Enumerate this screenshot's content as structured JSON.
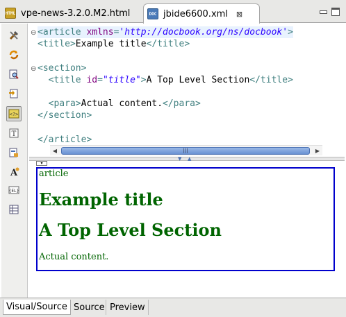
{
  "tabs": [
    {
      "label": "vpe-news-3.2.0.M2.html",
      "icon": "html-file-icon",
      "icon_text": "HTML",
      "active": false
    },
    {
      "label": "jbide6600.xml",
      "icon": "docbook-file-icon",
      "icon_text": "DOC",
      "active": true
    }
  ],
  "tab_close_glyph": "⊠",
  "palette": [
    "tools-icon",
    "refresh-icon",
    "preview-icon",
    "bundle-icon",
    "source-toggle-icon",
    "text-icon",
    "format-icon",
    "font-icon",
    "el-icon",
    "table-icon"
  ],
  "source": {
    "lines": [
      {
        "fold": "⊖",
        "parts": [
          [
            "t",
            "<article "
          ],
          [
            "an",
            "xmlns"
          ],
          [
            "t",
            "="
          ],
          [
            "av",
            "'http://docbook.org/ns/docbook'"
          ],
          [
            "t",
            ">"
          ]
        ],
        "highlight": true
      },
      {
        "fold": "",
        "parts": [
          [
            "t",
            "<title>"
          ],
          [
            "tx",
            "Example title"
          ],
          [
            "t",
            "</title>"
          ]
        ]
      },
      {
        "fold": "",
        "parts": []
      },
      {
        "fold": "⊖",
        "parts": [
          [
            "t",
            "<section>"
          ]
        ]
      },
      {
        "fold": "",
        "parts": [
          [
            "t",
            "  <title "
          ],
          [
            "an",
            "id"
          ],
          [
            "t",
            "="
          ],
          [
            "av",
            "\"title\""
          ],
          [
            "t",
            ">"
          ],
          [
            "tx",
            "A Top Level Section"
          ],
          [
            "t",
            "</title>"
          ]
        ]
      },
      {
        "fold": "",
        "parts": []
      },
      {
        "fold": "",
        "parts": [
          [
            "t",
            "  <para>"
          ],
          [
            "tx",
            "Actual content."
          ],
          [
            "t",
            "</para>"
          ]
        ]
      },
      {
        "fold": "",
        "parts": [
          [
            "t",
            "</section>"
          ]
        ]
      },
      {
        "fold": "",
        "parts": []
      },
      {
        "fold": "",
        "parts": [
          [
            "t",
            "</article>"
          ]
        ]
      }
    ]
  },
  "visual": {
    "article_label": "article",
    "title": "Example title",
    "section_title": "A Top Level Section",
    "para": "Actual content."
  },
  "bottom_tabs": [
    "Visual/Source",
    "Source",
    "Preview"
  ],
  "colors": {
    "tag": "#3f7f7f",
    "attr_name": "#7f007f",
    "attr_value": "#2a00ff",
    "visual_text": "#006400",
    "selection_border": "#0000cc"
  }
}
